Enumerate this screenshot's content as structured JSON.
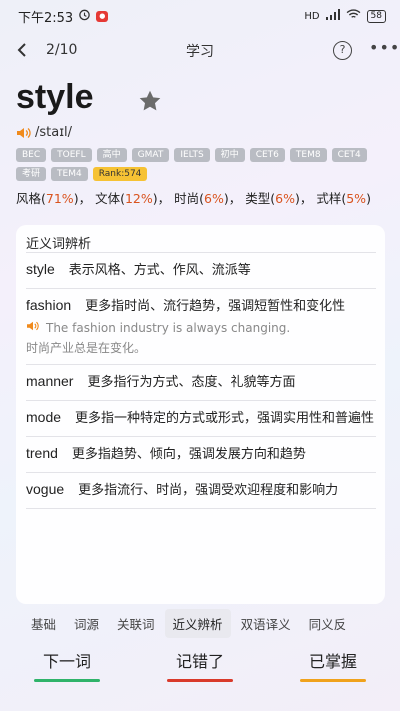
{
  "status": {
    "time": "下午2:53",
    "network": "HD",
    "battery": "58"
  },
  "nav": {
    "page": "2/10",
    "title": "学习"
  },
  "word": {
    "text": "style",
    "phonetic": "/staɪl/"
  },
  "tags": [
    "BEC",
    "TOEFL",
    "高中",
    "GMAT",
    "IELTS",
    "初中",
    "CET6",
    "TEM8",
    "CET4",
    "考研",
    "TEM4"
  ],
  "rank": "Rank:574",
  "frequency": [
    {
      "label": "风格(",
      "pct": "71%",
      "tail": ")，"
    },
    {
      "label": "文体(",
      "pct": "12%",
      "tail": ")，"
    },
    {
      "label": "时尚(",
      "pct": "6%",
      "tail": ")，"
    },
    {
      "label": "类型(",
      "pct": "6%",
      "tail": ")，"
    },
    {
      "label": "式样(",
      "pct": "5%",
      "tail": ")"
    }
  ],
  "synonyms": {
    "title": "近义词辨析",
    "items": [
      {
        "word": "style",
        "desc": "表示风格、方式、作风、流派等"
      },
      {
        "word": "fashion",
        "desc": "更多指时尚、流行趋势，强调短暂性和变化性",
        "example_en": "The fashion industry is always changing.",
        "example_zh": "时尚产业总是在变化。"
      },
      {
        "word": "manner",
        "desc": "更多指行为方式、态度、礼貌等方面"
      },
      {
        "word": "mode",
        "desc": "更多指一种特定的方式或形式，强调实用性和普遍性"
      },
      {
        "word": "trend",
        "desc": "更多指趋势、倾向，强调发展方向和趋势"
      },
      {
        "word": "vogue",
        "desc": "更多指流行、时尚，强调受欢迎程度和影响力"
      }
    ]
  },
  "tabs": [
    "基础",
    "词源",
    "关联词",
    "近义辨析",
    "双语译义",
    "同义反"
  ],
  "active_tab": "近义辨析",
  "actions": [
    {
      "label": "下一词",
      "color": "#2fb36a"
    },
    {
      "label": "记错了",
      "color": "#d93a2b"
    },
    {
      "label": "已掌握",
      "color": "#f0a21c"
    }
  ],
  "colors": {
    "accent": "#d9531e",
    "speaker": "#f08a1c"
  }
}
